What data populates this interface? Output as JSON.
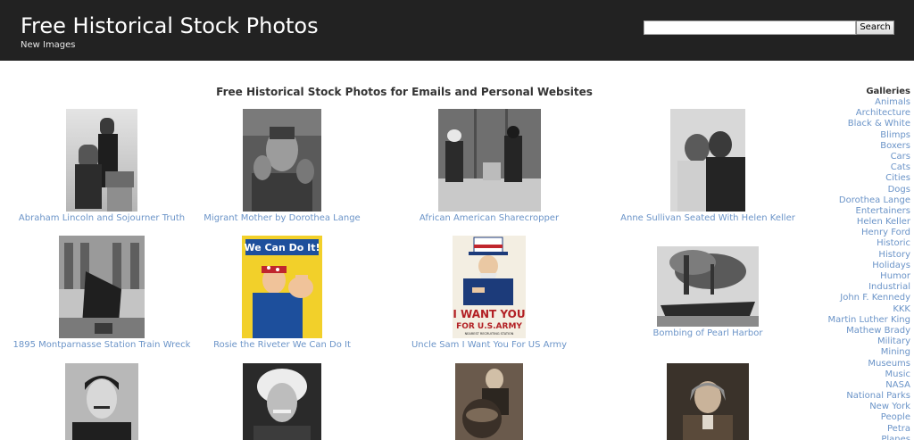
{
  "header": {
    "title": "Free Historical Stock Photos",
    "new_images": "New Images",
    "search_placeholder": "",
    "search_label": "Search",
    "background": "#222222"
  },
  "main": {
    "heading": "Free Historical Stock Photos for Emails and Personal Websites",
    "link_color": "#6b94c8",
    "photos": [
      {
        "caption": "Abraham Lincoln and Sojourner Truth"
      },
      {
        "caption": "Migrant Mother by Dorothea Lange"
      },
      {
        "caption": "African American Sharecropper"
      },
      {
        "caption": "Anne Sullivan Seated With Helen Keller"
      },
      {
        "caption": "1895 Montparnasse Station Train Wreck"
      },
      {
        "caption": "Rosie the Riveter We Can Do It",
        "poster_text": "We Can Do It!"
      },
      {
        "caption": "Uncle Sam I Want You For US Army",
        "poster_text": "I WANT YOU",
        "poster_text2": "FOR U.S.ARMY",
        "poster_text3": "NEAREST RECRUITING STATION"
      },
      {
        "caption": "Bombing of Pearl Harbor"
      },
      {
        "caption": ""
      },
      {
        "caption": ""
      },
      {
        "caption": ""
      },
      {
        "caption": ""
      }
    ]
  },
  "sidebar": {
    "title": "Galleries",
    "items": [
      "Animals",
      "Architecture",
      "Black & White",
      "Blimps",
      "Boxers",
      "Cars",
      "Cats",
      "Cities",
      "Dogs",
      "Dorothea Lange",
      "Entertainers",
      "Helen Keller",
      "Henry Ford",
      "Historic",
      "History",
      "Holidays",
      "Humor",
      "Industrial",
      "John F. Kennedy",
      "KKK",
      "Martin Luther King",
      "Mathew Brady",
      "Military",
      "Mining",
      "Museums",
      "Music",
      "NASA",
      "National Parks",
      "New York",
      "People",
      "Petra",
      "Planes"
    ]
  }
}
